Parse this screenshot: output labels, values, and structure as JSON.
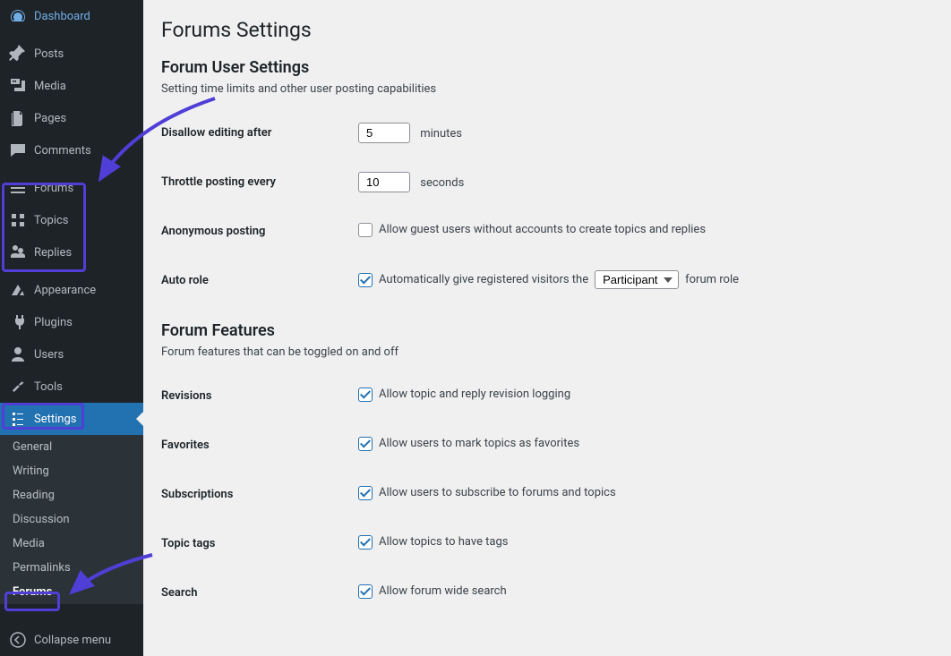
{
  "sidebar": {
    "items": [
      {
        "label": "Dashboard"
      },
      {
        "label": "Posts"
      },
      {
        "label": "Media"
      },
      {
        "label": "Pages"
      },
      {
        "label": "Comments"
      },
      {
        "label": "Forums"
      },
      {
        "label": "Topics"
      },
      {
        "label": "Replies"
      },
      {
        "label": "Appearance"
      },
      {
        "label": "Plugins"
      },
      {
        "label": "Users"
      },
      {
        "label": "Tools"
      },
      {
        "label": "Settings"
      }
    ],
    "submenu": [
      {
        "label": "General"
      },
      {
        "label": "Writing"
      },
      {
        "label": "Reading"
      },
      {
        "label": "Discussion"
      },
      {
        "label": "Media"
      },
      {
        "label": "Permalinks"
      },
      {
        "label": "Forums"
      }
    ],
    "collapse": "Collapse menu"
  },
  "page": {
    "title": "Forums Settings",
    "user_settings": {
      "heading": "Forum User Settings",
      "desc": "Setting time limits and other user posting capabilities",
      "disallow_label": "Disallow editing after",
      "disallow_value": "5",
      "disallow_unit": "minutes",
      "throttle_label": "Throttle posting every",
      "throttle_value": "10",
      "throttle_unit": "seconds",
      "anon_label": "Anonymous posting",
      "anon_cb": "Allow guest users without accounts to create topics and replies",
      "autorole_label": "Auto role",
      "autorole_pre": "Automatically give registered visitors the ",
      "autorole_select": "Participant",
      "autorole_post": " forum role"
    },
    "features": {
      "heading": "Forum Features",
      "desc": "Forum features that can be toggled on and off",
      "revisions_label": "Revisions",
      "revisions_cb": "Allow topic and reply revision logging",
      "favorites_label": "Favorites",
      "favorites_cb": "Allow users to mark topics as favorites",
      "subs_label": "Subscriptions",
      "subs_cb": "Allow users to subscribe to forums and topics",
      "tags_label": "Topic tags",
      "tags_cb": "Allow topics to have tags",
      "search_label": "Search",
      "search_cb": "Allow forum wide search"
    }
  }
}
